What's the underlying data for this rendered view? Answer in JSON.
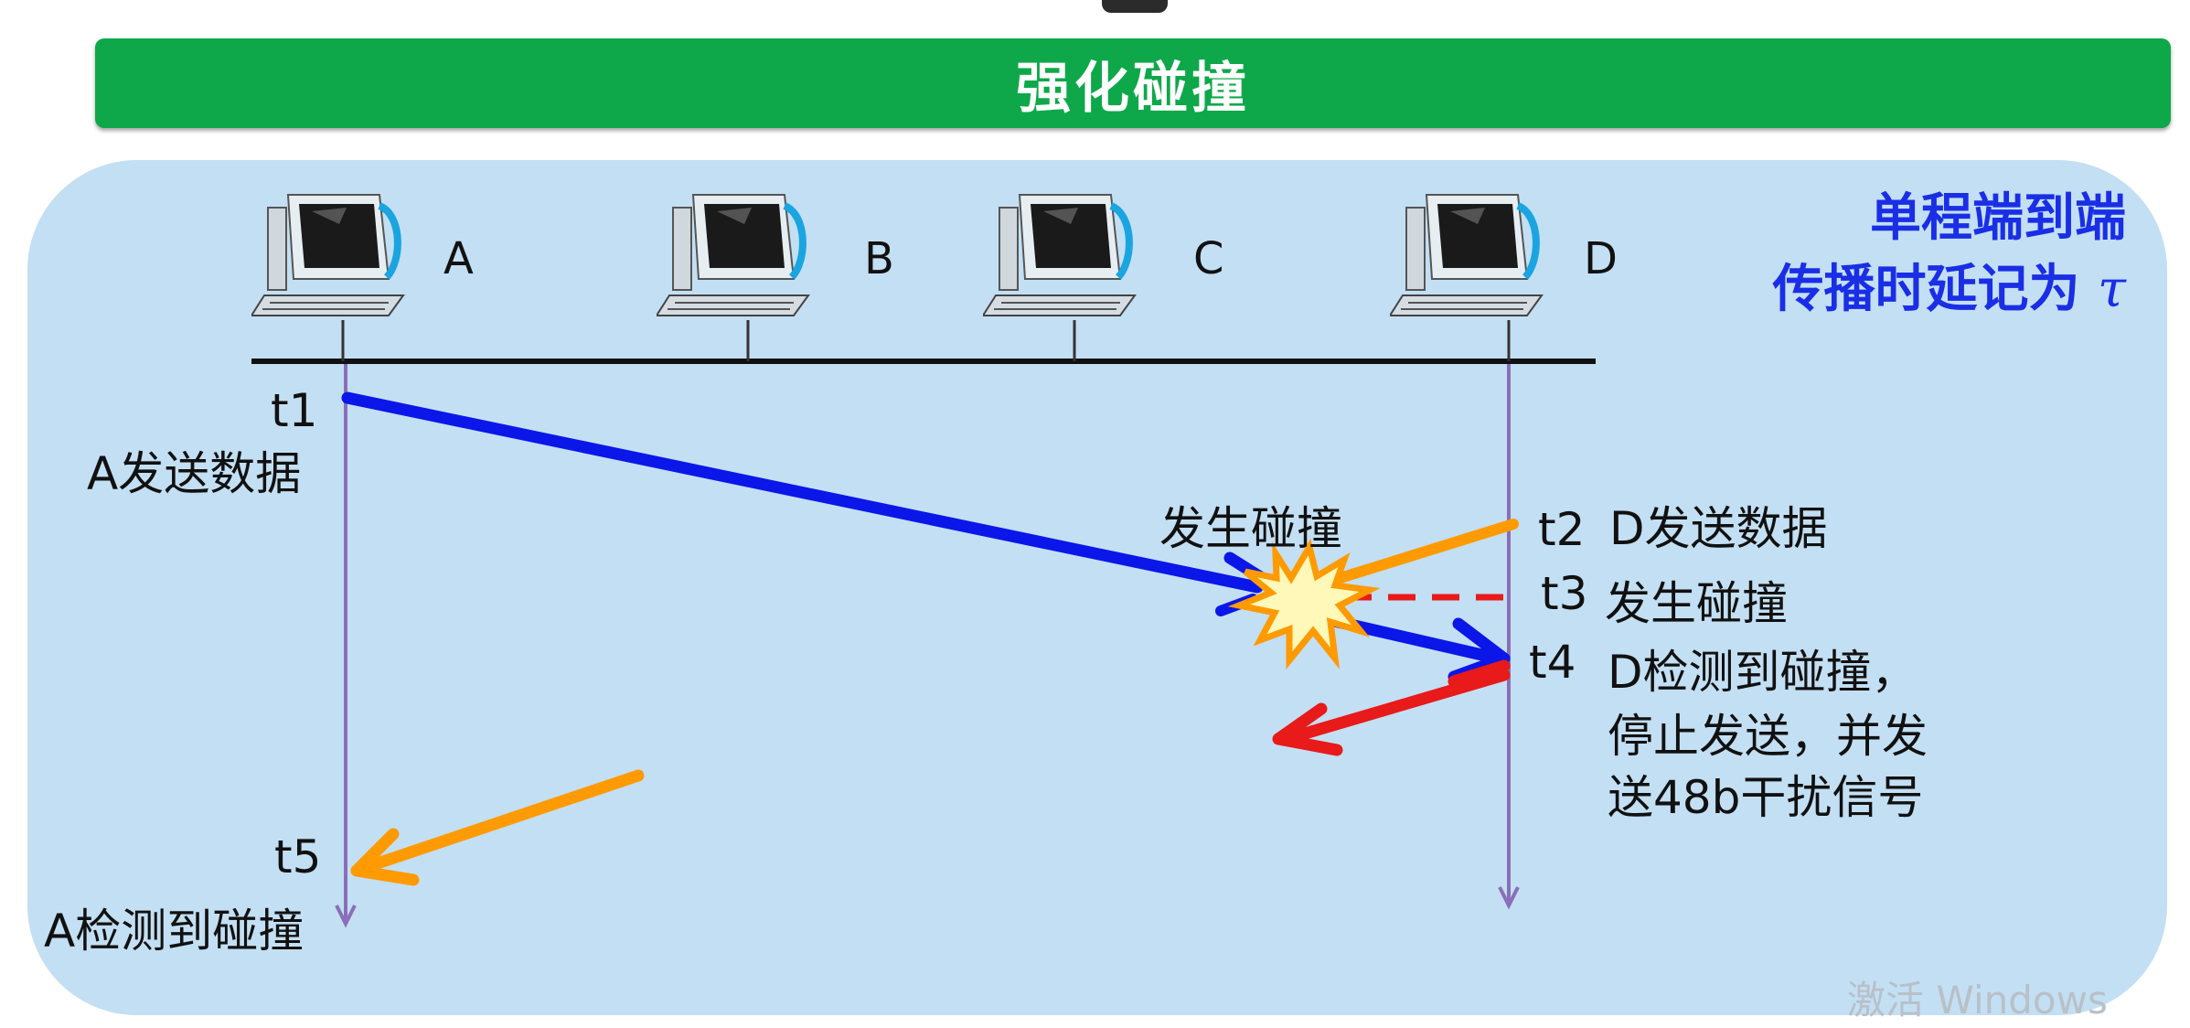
{
  "title": "强化碰撞",
  "note": {
    "line1": "单程端到端",
    "line2": "传播时延记为",
    "symbol": "τ"
  },
  "nodes": [
    {
      "id": "A",
      "label": "A"
    },
    {
      "id": "B",
      "label": "B"
    },
    {
      "id": "C",
      "label": "C"
    },
    {
      "id": "D",
      "label": "D"
    }
  ],
  "events": {
    "t1": {
      "time": "t1",
      "text": "A发送数据"
    },
    "collision_mid": "发生碰撞",
    "t2": {
      "time": "t2",
      "text": "D发送数据"
    },
    "t3": {
      "time": "t3",
      "text": "发生碰撞"
    },
    "t4": {
      "time": "t4",
      "line1": "D检测到碰撞，",
      "line2": "停止发送，并发",
      "line3": "送48b干扰信号"
    },
    "t5": {
      "time": "t5",
      "text": "A检测到碰撞"
    }
  },
  "colors": {
    "title_bar": "#0ea84a",
    "panel": "#c3dff3",
    "note": "#1a2ee6",
    "signal_a": "#0a17e8",
    "signal_d": "#ff9a00",
    "jam": "#e81a1a",
    "timeline": "#8a6fb8"
  },
  "watermark": "激活 Windows"
}
